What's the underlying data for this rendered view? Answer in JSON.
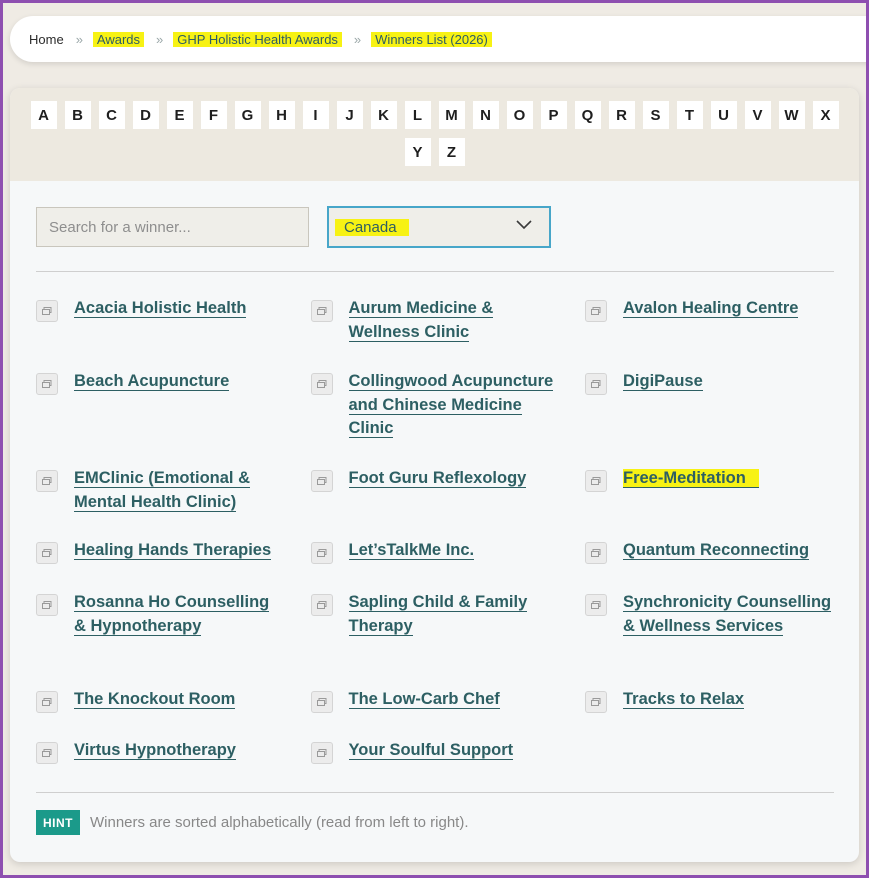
{
  "breadcrumb": {
    "home": "Home",
    "awards": "Awards",
    "program": "GHP Holistic Health Awards",
    "current": "Winners List (2026)",
    "separator": "»"
  },
  "alphabet": [
    "A",
    "B",
    "C",
    "D",
    "E",
    "F",
    "G",
    "H",
    "I",
    "J",
    "K",
    "L",
    "M",
    "N",
    "O",
    "P",
    "Q",
    "R",
    "S",
    "T",
    "U",
    "V",
    "W",
    "X",
    "Y",
    "Z"
  ],
  "search": {
    "placeholder": "Search for a winner..."
  },
  "country_select": {
    "value": "Canada",
    "icon": "chevron-down-icon"
  },
  "winners": [
    "Acacia Holistic Health",
    "Aurum Medicine & Wellness Clinic",
    "Avalon Healing Centre",
    "Beach Acupuncture",
    "Collingwood Acupuncture and Chinese Medicine Clinic",
    "DigiPause",
    "EMClinic (Emotional & Mental Health Clinic)",
    "Foot Guru Reflexology",
    "Free-Meditation",
    "Healing Hands Therapies",
    "Let’sTalkMe Inc.",
    "Quantum Reconnecting",
    "Rosanna Ho Counselling & Hypnotherapy",
    "Sapling Child & Family Therapy",
    "Synchronicity Counselling & Wellness Services",
    "The Knockout Room",
    "The Low-Carb Chef",
    "Tracks to Relax",
    "Virtus Hypnotherapy",
    "Your Soulful Support"
  ],
  "hint": {
    "badge": "HINT",
    "text": "Winners are sorted alphabetically (read from left to right)."
  },
  "colors": {
    "accent": "#2d5f63",
    "highlight": "#f7f214",
    "hint_badge": "#1b9a8a",
    "select_border": "#47a6c9"
  }
}
